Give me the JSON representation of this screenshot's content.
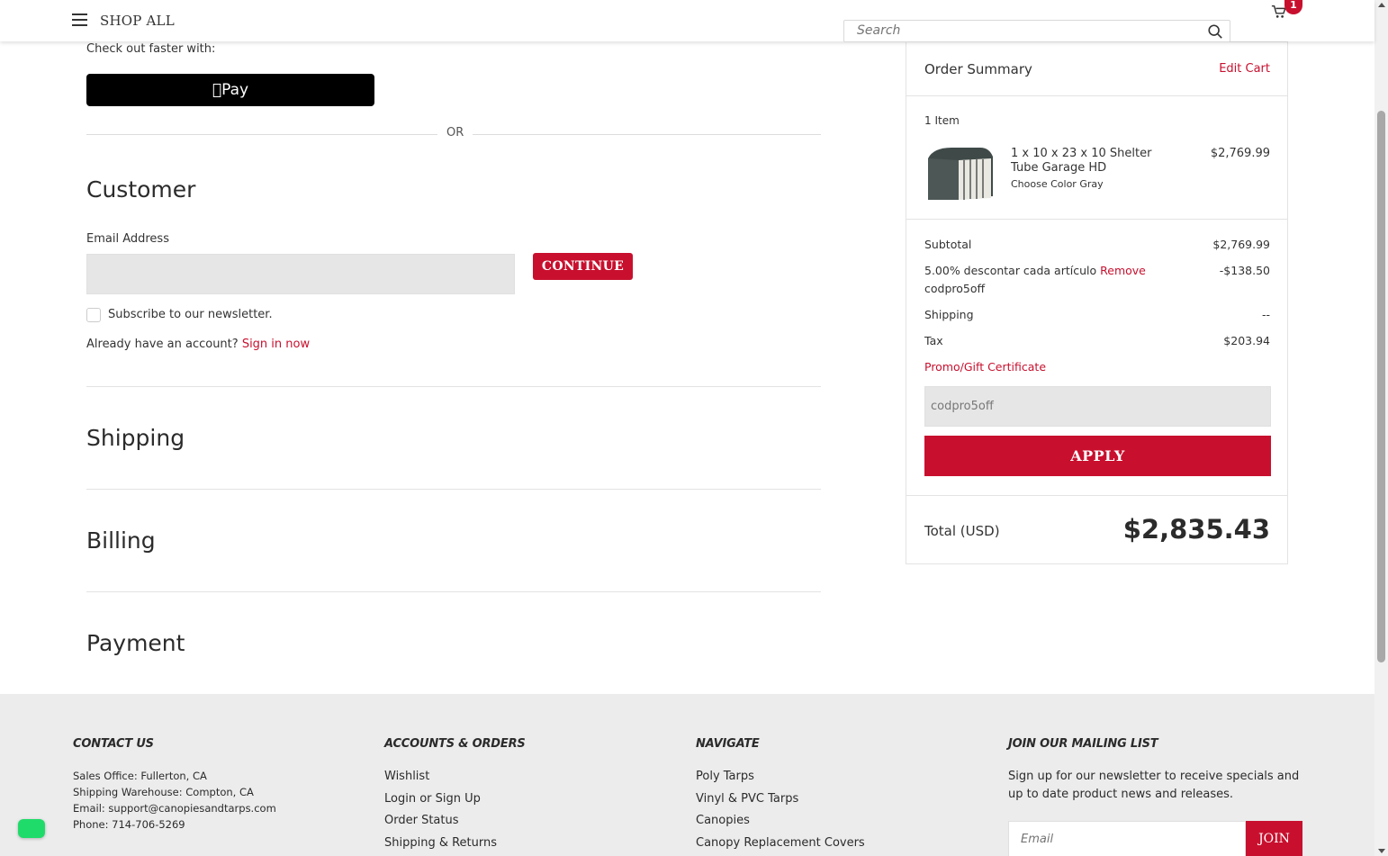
{
  "header": {
    "shop_all": "SHOP ALL",
    "search_placeholder": "Search",
    "cart_count": "1"
  },
  "checkout": {
    "faster_text": "Check out faster with:",
    "apple_pay_label": "Pay",
    "or_text": "OR",
    "customer_title": "Customer",
    "email_label": "Email Address",
    "email_value": "",
    "continue_label": "CONTINUE",
    "newsletter_label": "Subscribe to our newsletter.",
    "account_prompt": "Already have an account?",
    "sign_in_label": "Sign in now",
    "shipping_title": "Shipping",
    "billing_title": "Billing",
    "payment_title": "Payment"
  },
  "summary": {
    "title": "Order Summary",
    "edit_cart": "Edit Cart",
    "item_count": "1 Item",
    "product_name": "1 x 10 x 23 x 10 Shelter Tube Garage HD",
    "product_option": "Choose Color Gray",
    "product_price": "$2,769.99",
    "subtotal_label": "Subtotal",
    "subtotal_value": "$2,769.99",
    "discount_label": "5.00% descontar cada artículo",
    "discount_remove": "Remove",
    "discount_code": "codpro5off",
    "discount_value": "-$138.50",
    "shipping_label": "Shipping",
    "shipping_value": "--",
    "tax_label": "Tax",
    "tax_value": "$203.94",
    "promo_link": "Promo/Gift Certificate",
    "promo_value": "codpro5off",
    "apply_label": "APPLY",
    "total_label": "Total (USD)",
    "total_value": "$2,835.43"
  },
  "footer": {
    "contact_title": "CONTACT US",
    "contact_lines": [
      "Sales Office: Fullerton, CA",
      "Shipping Warehouse: Compton, CA",
      "Email: support@canopiesandtarps.com",
      "Phone: 714-706-5269"
    ],
    "accounts_title": "ACCOUNTS & ORDERS",
    "accounts_links": [
      "Wishlist",
      "Login or Sign Up",
      "Order Status",
      "Shipping & Returns"
    ],
    "navigate_title": "NAVIGATE",
    "navigate_links": [
      "Poly Tarps",
      "Vinyl & PVC Tarps",
      "Canopies",
      "Canopy Replacement Covers"
    ],
    "mailing_title": "JOIN OUR MAILING LIST",
    "mailing_text": "Sign up for our newsletter to receive specials and up to date product news and releases.",
    "email_placeholder": "Email",
    "join_label": "JOIN"
  },
  "colors": {
    "accent": "#c8102e",
    "footer_bg": "#ececec",
    "chat_button": "#1fdc6a"
  },
  "icons": [
    "menu-icon",
    "search-icon",
    "cart-icon",
    "apple-icon",
    "chat-icon"
  ]
}
